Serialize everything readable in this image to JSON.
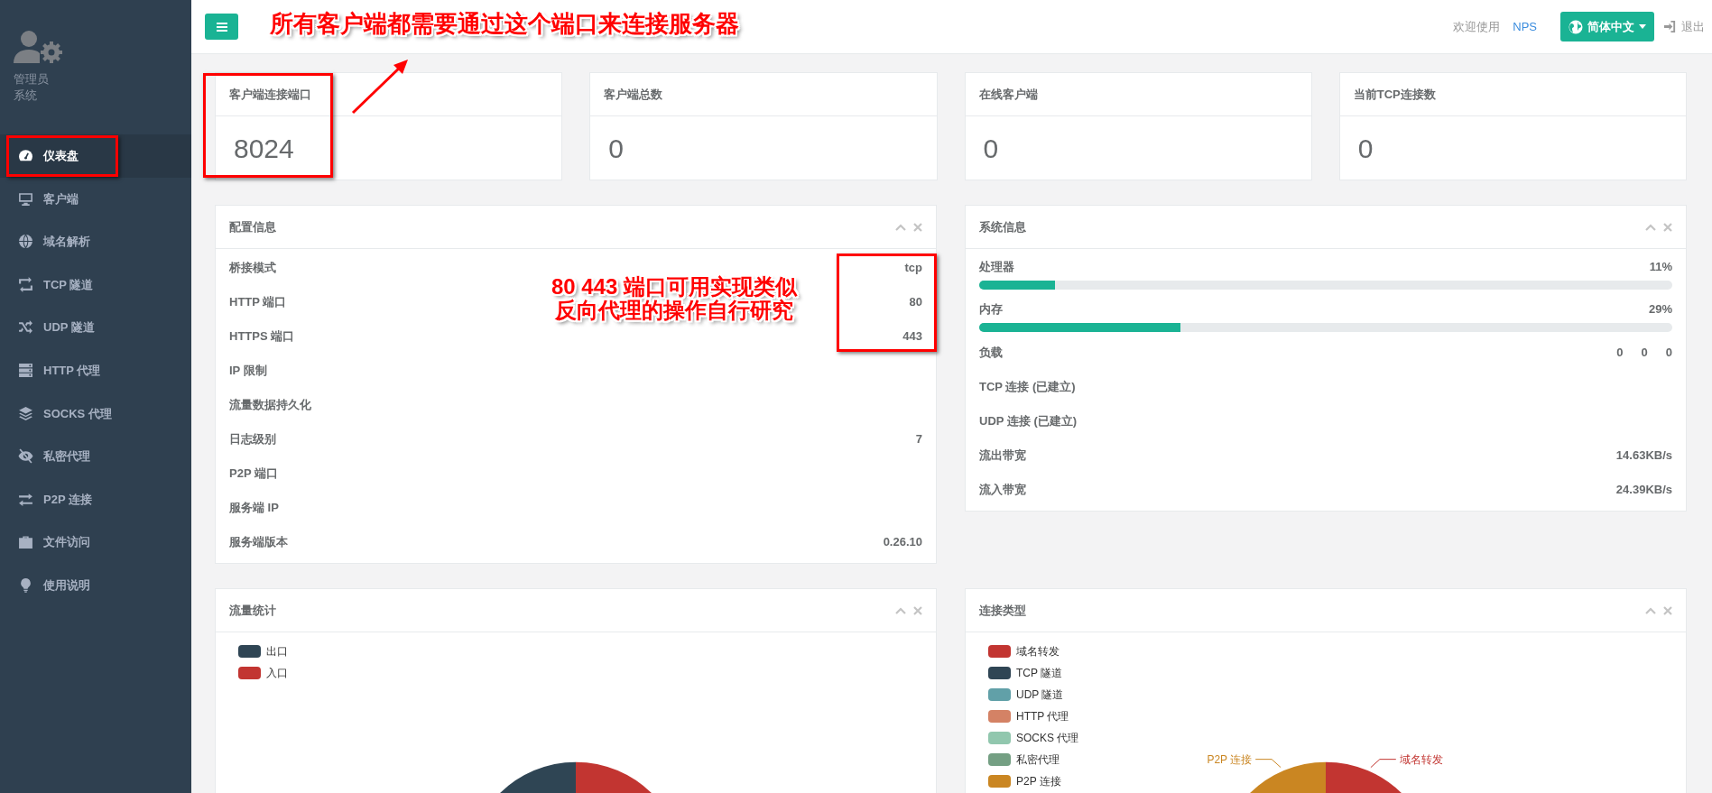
{
  "sidebar": {
    "profile": {
      "name": "管理员",
      "role": "系统"
    },
    "items": [
      {
        "label": "仪表盘",
        "selected": true
      },
      {
        "label": "客户端",
        "selected": false
      },
      {
        "label": "域名解析",
        "selected": false
      },
      {
        "label": "TCP 隧道",
        "selected": false
      },
      {
        "label": "UDP 隧道",
        "selected": false
      },
      {
        "label": "HTTP 代理",
        "selected": false
      },
      {
        "label": "SOCKS 代理",
        "selected": false
      },
      {
        "label": "私密代理",
        "selected": false
      },
      {
        "label": "P2P 连接",
        "selected": false
      },
      {
        "label": "文件访问",
        "selected": false
      },
      {
        "label": "使用说明",
        "selected": false
      }
    ]
  },
  "topbar": {
    "welcome": "欢迎使用",
    "brand": "NPS",
    "language": "简体中文",
    "logout": "退出"
  },
  "stats": [
    {
      "title": "客户端连接端口",
      "value": "8024"
    },
    {
      "title": "客户端总数",
      "value": "0"
    },
    {
      "title": "在线客户端",
      "value": "0"
    },
    {
      "title": "当前TCP连接数",
      "value": "0"
    }
  ],
  "config_panel": {
    "title": "配置信息",
    "rows": [
      {
        "label": "桥接模式",
        "value": "tcp"
      },
      {
        "label": "HTTP 端口",
        "value": "80"
      },
      {
        "label": "HTTPS 端口",
        "value": "443"
      },
      {
        "label": "IP 限制"
      },
      {
        "label": "流量数据持久化"
      },
      {
        "label": "日志级别",
        "value": "7"
      },
      {
        "label": "P2P 端口"
      },
      {
        "label": "服务端 IP"
      },
      {
        "label": "服务端版本",
        "value": "0.26.10"
      }
    ]
  },
  "system_panel": {
    "title": "系统信息",
    "rows": [
      {
        "kind": "meter",
        "label": "处理器",
        "reading": "11%",
        "level": 0.11
      },
      {
        "kind": "meter",
        "label": "内存",
        "reading": "29%",
        "level": 0.29
      },
      {
        "kind": "multi",
        "label": "负载",
        "values": [
          "0",
          "0",
          "0"
        ]
      },
      {
        "kind": "text",
        "label": "TCP 连接 (已建立)"
      },
      {
        "kind": "text",
        "label": "UDP 连接 (已建立)"
      },
      {
        "kind": "text",
        "label": "流出带宽",
        "value": "14.63KB/s"
      },
      {
        "kind": "text",
        "label": "流入带宽",
        "value": "24.39KB/s"
      }
    ]
  },
  "traffic_panel": {
    "title": "流量统计",
    "legend": [
      {
        "label": "出口",
        "color": "#2f4554"
      },
      {
        "label": "入口",
        "color": "#c23531"
      }
    ]
  },
  "connection_panel": {
    "title": "连接类型",
    "legend": [
      {
        "label": "域名转发",
        "color": "#c23531"
      },
      {
        "label": "TCP 隧道",
        "color": "#2f4554"
      },
      {
        "label": "UDP 隧道",
        "color": "#61a0a8"
      },
      {
        "label": "HTTP 代理",
        "color": "#d48265"
      },
      {
        "label": "SOCKS 代理",
        "color": "#91c7ae"
      },
      {
        "label": "私密代理",
        "color": "#749f83"
      },
      {
        "label": "P2P 连接",
        "color": "#ca8622"
      }
    ],
    "slice_labels": [
      {
        "label": "P2P 连接",
        "color": "#ca8622"
      },
      {
        "label": "域名转发",
        "color": "#c23531"
      }
    ]
  },
  "annotations": [
    {
      "lines": [
        "所有客户端都需要通过这个端口来连接服务器"
      ]
    },
    {
      "lines": [
        "80 443 端口可用实现类似",
        "反向代理的操作自行研究"
      ]
    }
  ]
}
